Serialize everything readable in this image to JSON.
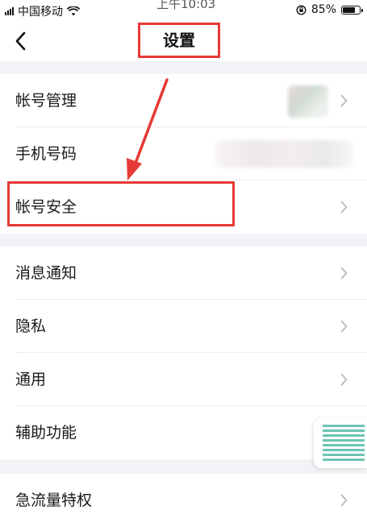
{
  "status_bar": {
    "carrier": "中国移动",
    "time": "上午10:03",
    "battery_text": "85%",
    "battery_level": 0.85
  },
  "header": {
    "back_icon": "chevron-left-icon",
    "title": "设置"
  },
  "groups": [
    {
      "items": [
        {
          "label": "帐号管理",
          "has_chevron": true
        },
        {
          "label": "手机号码",
          "has_chevron": false
        },
        {
          "label": "帐号安全",
          "has_chevron": true,
          "highlighted": true
        }
      ]
    },
    {
      "items": [
        {
          "label": "消息通知",
          "has_chevron": true
        },
        {
          "label": "隐私",
          "has_chevron": true
        },
        {
          "label": "通用",
          "has_chevron": true
        },
        {
          "label": "辅助功能",
          "has_chevron": false
        }
      ]
    },
    {
      "items": [
        {
          "label": "急流量特权",
          "has_chevron": true
        }
      ]
    }
  ],
  "annotation_color": "#e53935",
  "accent_color": "#6ec4b4"
}
